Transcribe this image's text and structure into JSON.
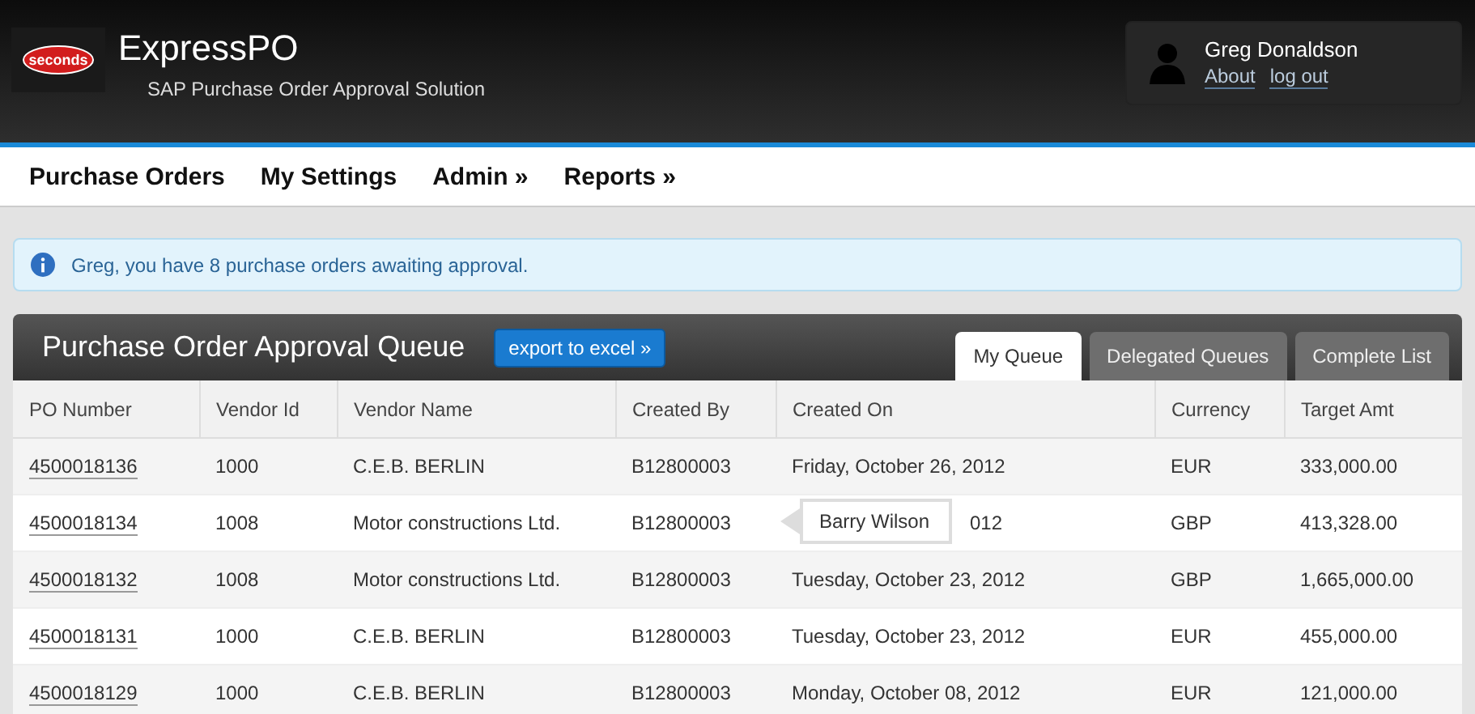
{
  "header": {
    "logo_text": "seconds",
    "title": "ExpressPO",
    "subtitle": "SAP Purchase Order Approval Solution",
    "user": {
      "name": "Greg Donaldson",
      "links": [
        "About",
        "log out"
      ]
    }
  },
  "nav": {
    "items": [
      "Purchase Orders",
      "My Settings",
      "Admin »",
      "Reports »"
    ]
  },
  "alert": {
    "message": "Greg, you have 8 purchase orders awaiting approval."
  },
  "queue": {
    "title": "Purchase Order Approval Queue",
    "export_button": "export to excel »",
    "tabs": [
      {
        "label": "My Queue",
        "selected": true
      },
      {
        "label": "Delegated Queues",
        "selected": false
      },
      {
        "label": "Complete List",
        "selected": false
      }
    ],
    "table": {
      "columns": [
        "PO Number",
        "Vendor Id",
        "Vendor Name",
        "Created By",
        "Created On",
        "Currency",
        "Target Amt"
      ],
      "rows": [
        {
          "po_number": "4500018136",
          "vendor_id": "1000",
          "vendor_name": "C.E.B. BERLIN",
          "created_by": "B12800003",
          "created_on": "Friday, October 26, 2012",
          "currency": "EUR",
          "target_amt": "333,000.00"
        },
        {
          "po_number": "4500018134",
          "vendor_id": "1008",
          "vendor_name": "Motor constructions Ltd.",
          "created_by": "B12800003",
          "created_on": "012",
          "tooltip": "Barry Wilson",
          "currency": "GBP",
          "target_amt": "413,328.00"
        },
        {
          "po_number": "4500018132",
          "vendor_id": "1008",
          "vendor_name": "Motor constructions Ltd.",
          "created_by": "B12800003",
          "created_on": "Tuesday, October 23, 2012",
          "currency": "GBP",
          "target_amt": "1,665,000.00"
        },
        {
          "po_number": "4500018131",
          "vendor_id": "1000",
          "vendor_name": "C.E.B. BERLIN",
          "created_by": "B12800003",
          "created_on": "Tuesday, October 23, 2012",
          "currency": "EUR",
          "target_amt": "455,000.00"
        },
        {
          "po_number": "4500018129",
          "vendor_id": "1000",
          "vendor_name": "C.E.B. BERLIN",
          "created_by": "B12800003",
          "created_on": "Monday, October 08, 2012",
          "currency": "EUR",
          "target_amt": "121,000.00"
        }
      ]
    }
  }
}
